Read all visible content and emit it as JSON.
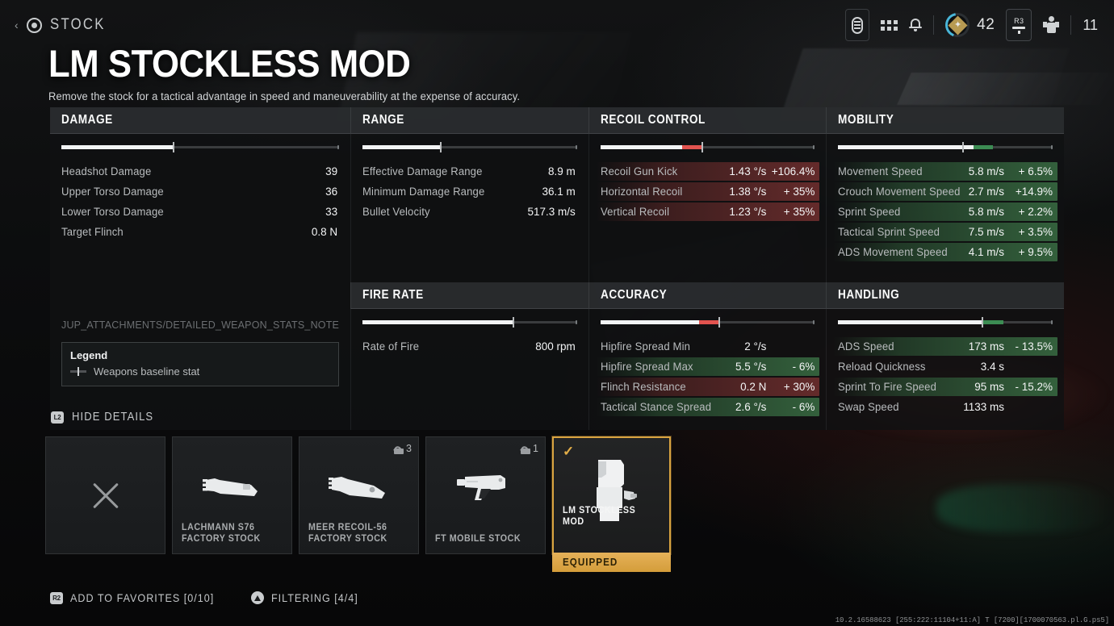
{
  "header": {
    "back_icon": "circle-target-icon",
    "chevron": "‹",
    "breadcrumb": "STOCK",
    "title": "LM STOCKLESS MOD",
    "description": "Remove the stock for a tactical advantage in speed and maneuverability at the expense of accuracy."
  },
  "top_right": {
    "battlepass_icon": "battlepass-token-icon",
    "apps_icon": "apps-grid-icon",
    "notifications_icon": "bell-icon",
    "rank_icon": "rank-badge-icon",
    "rank_value": "42",
    "r3_button_label": "R3",
    "r3_icon": "right-stick-icon",
    "operator_icon": "operator-icon",
    "operator_count": "11"
  },
  "panels": [
    {
      "id": "damage",
      "title": "DAMAGE",
      "bar": {
        "fill_pct": 40,
        "tick_pct": 40,
        "ext_pct": 0,
        "ext_type": "none"
      },
      "rows": [
        {
          "name": "Headshot Damage",
          "value": "39",
          "delta": "",
          "type": "none"
        },
        {
          "name": "Upper Torso Damage",
          "value": "36",
          "delta": "",
          "type": "none"
        },
        {
          "name": "Lower Torso Damage",
          "value": "33",
          "delta": "",
          "type": "none"
        },
        {
          "name": "Target Flinch",
          "value": "0.8 N",
          "delta": "",
          "type": "none"
        }
      ],
      "note": "JUP_ATTACHMENTS/DETAILED_WEAPON_STATS_NOTE",
      "legend": {
        "title": "Legend",
        "entry": "Weapons baseline stat"
      }
    },
    {
      "id": "range",
      "title": "RANGE",
      "bar": {
        "fill_pct": 36,
        "tick_pct": 36,
        "ext_pct": 0,
        "ext_type": "none"
      },
      "rows": [
        {
          "name": "Effective Damage Range",
          "value": "8.9 m",
          "delta": "",
          "type": "none"
        },
        {
          "name": "Minimum Damage Range",
          "value": "36.1 m",
          "delta": "",
          "type": "none"
        },
        {
          "name": "Bullet Velocity",
          "value": "517.3 m/s",
          "delta": "",
          "type": "none"
        }
      ]
    },
    {
      "id": "recoil-control",
      "title": "RECOIL CONTROL",
      "bar": {
        "fill_pct": 38,
        "tick_pct": 47,
        "ext_pct": 9,
        "ext_type": "neg"
      },
      "rows": [
        {
          "name": "Recoil Gun Kick",
          "value": "1.43 °/s",
          "delta": "+106.4%",
          "type": "neg"
        },
        {
          "name": "Horizontal Recoil",
          "value": "1.38 °/s",
          "delta": "+ 35%",
          "type": "neg"
        },
        {
          "name": "Vertical Recoil",
          "value": "1.23 °/s",
          "delta": "+ 35%",
          "type": "neg"
        }
      ]
    },
    {
      "id": "mobility",
      "title": "MOBILITY",
      "bar": {
        "fill_pct": 63,
        "tick_pct": 58,
        "ext_pct": 9,
        "ext_type": "pos"
      },
      "rows": [
        {
          "name": "Movement Speed",
          "value": "5.8 m/s",
          "delta": "+ 6.5%",
          "type": "pos"
        },
        {
          "name": "Crouch Movement Speed",
          "value": "2.7 m/s",
          "delta": "+14.9%",
          "type": "pos"
        },
        {
          "name": "Sprint Speed",
          "value": "5.8 m/s",
          "delta": "+ 2.2%",
          "type": "pos"
        },
        {
          "name": "Tactical Sprint Speed",
          "value": "7.5 m/s",
          "delta": "+ 3.5%",
          "type": "pos"
        },
        {
          "name": "ADS Movement Speed",
          "value": "4.1 m/s",
          "delta": "+ 9.5%",
          "type": "pos"
        }
      ]
    },
    {
      "id": "fire-rate",
      "title": "FIRE RATE",
      "bar": {
        "fill_pct": 70,
        "tick_pct": 70,
        "ext_pct": 0,
        "ext_type": "none"
      },
      "rows": [
        {
          "name": "Rate of Fire",
          "value": "800 rpm",
          "delta": "",
          "type": "none"
        }
      ]
    },
    {
      "id": "accuracy",
      "title": "ACCURACY",
      "bar": {
        "fill_pct": 46,
        "tick_pct": 55,
        "ext_pct": 9,
        "ext_type": "neg"
      },
      "rows": [
        {
          "name": "Hipfire Spread Min",
          "value": "2 °/s",
          "delta": "",
          "type": "none"
        },
        {
          "name": "Hipfire Spread Max",
          "value": "5.5 °/s",
          "delta": "- 6%",
          "type": "pos"
        },
        {
          "name": "Flinch Resistance",
          "value": "0.2 N",
          "delta": "+ 30%",
          "type": "neg"
        },
        {
          "name": "Tactical Stance Spread",
          "value": "2.6 °/s",
          "delta": "- 6%",
          "type": "pos"
        }
      ]
    },
    {
      "id": "handling",
      "title": "HANDLING",
      "bar": {
        "fill_pct": 67,
        "tick_pct": 67,
        "ext_pct": 10,
        "ext_type": "pos"
      },
      "rows": [
        {
          "name": "ADS Speed",
          "value": "173 ms",
          "delta": "- 13.5%",
          "type": "pos"
        },
        {
          "name": "Reload Quickness",
          "value": "3.4 s",
          "delta": "",
          "type": "none"
        },
        {
          "name": "Sprint To Fire Speed",
          "value": "95 ms",
          "delta": "- 15.2%",
          "type": "pos"
        },
        {
          "name": "Swap Speed",
          "value": "1133 ms",
          "delta": "",
          "type": "none"
        }
      ]
    }
  ],
  "hide_details": {
    "button_glyph": "L2",
    "label": "HIDE DETAILS"
  },
  "attachments": [
    {
      "id": "none",
      "name": "",
      "state": "empty",
      "icon": "x-remove-icon",
      "lock_count": ""
    },
    {
      "id": "lachmann-s76",
      "name": "LACHMANN S76\nFACTORY STOCK",
      "state": "available",
      "icon": "stock-lachmann-icon",
      "lock_count": ""
    },
    {
      "id": "meer-recoil-56",
      "name": "MEER RECOIL-56\nFACTORY STOCK",
      "state": "locked",
      "icon": "stock-meer-icon",
      "lock_count": "3"
    },
    {
      "id": "ft-mobile-stock",
      "name": "FT MOBILE STOCK",
      "state": "locked",
      "icon": "stock-ft-mobile-icon",
      "lock_count": "1"
    },
    {
      "id": "lm-stockless-mod",
      "name": "LM STOCKLESS MOD",
      "state": "equipped",
      "icon": "stock-lm-stockless-icon",
      "lock_count": "",
      "banner": "EQUIPPED",
      "check": "✓"
    }
  ],
  "footer": {
    "favorites_glyph": "R2",
    "favorites_label": "ADD TO FAVORITES [0/10]",
    "filtering_glyph": "triangle-icon",
    "filtering_label": "FILTERING [4/4]"
  },
  "build_string": "10.2.16588623 [255:222:11104+11:A] T [7200][1700070563.pl.G.ps5]",
  "colors": {
    "accent_gold": "#d9a441",
    "positive_green": "#3c8c53",
    "negative_red": "#e2534f",
    "bar_white": "#f2f4f5"
  }
}
